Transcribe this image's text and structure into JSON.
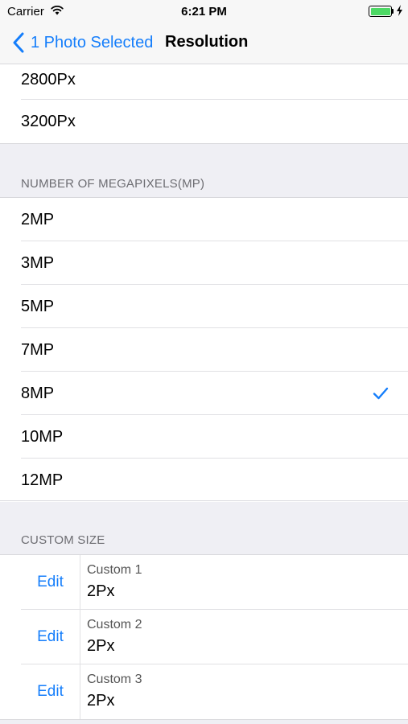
{
  "status_bar": {
    "carrier": "Carrier",
    "time": "6:21 PM"
  },
  "nav": {
    "back_label": "1 Photo Selected",
    "title": "Resolution"
  },
  "pixel_section": {
    "items": [
      {
        "label": "2800Px"
      },
      {
        "label": "3200Px"
      }
    ]
  },
  "megapixel_section": {
    "header": "NUMBER OF MEGAPIXELS(MP)",
    "selected": "8MP",
    "items": [
      {
        "label": "2MP"
      },
      {
        "label": "3MP"
      },
      {
        "label": "5MP"
      },
      {
        "label": "7MP"
      },
      {
        "label": "8MP"
      },
      {
        "label": "10MP"
      },
      {
        "label": "12MP"
      }
    ]
  },
  "custom_section": {
    "header": "CUSTOM SIZE",
    "items": [
      {
        "edit_label": "Edit",
        "name": "Custom 1",
        "size": "2Px"
      },
      {
        "edit_label": "Edit",
        "name": "Custom 2",
        "size": "2Px"
      },
      {
        "edit_label": "Edit",
        "name": "Custom 3",
        "size": "2Px"
      }
    ]
  },
  "colors": {
    "accent": "#157efb",
    "battery": "#4cd964",
    "background": "#efeff4"
  }
}
